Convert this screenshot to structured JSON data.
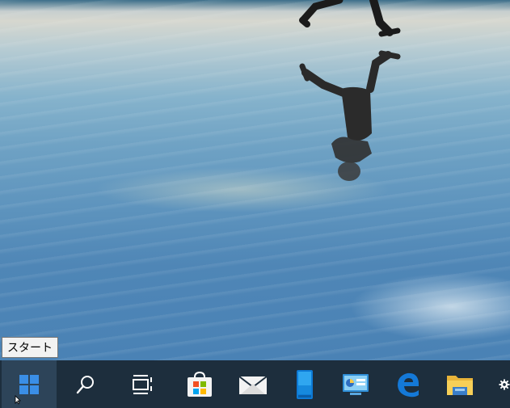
{
  "wallpaper": {
    "description_icon": "beach-reflection-wallpaper"
  },
  "tooltip": {
    "text": "スタート"
  },
  "taskbar": {
    "items": [
      {
        "name": "start-button",
        "icon": "windows-logo-icon"
      },
      {
        "name": "search-button",
        "icon": "search-icon"
      },
      {
        "name": "task-view-button",
        "icon": "task-view-icon"
      },
      {
        "name": "microsoft-store-button",
        "icon": "store-icon"
      },
      {
        "name": "mail-button",
        "icon": "mail-icon"
      },
      {
        "name": "phone-button",
        "icon": "phone-icon"
      },
      {
        "name": "control-panel-button",
        "icon": "control-panel-icon"
      },
      {
        "name": "edge-button",
        "icon": "edge-icon"
      },
      {
        "name": "file-explorer-button",
        "icon": "folder-icon"
      },
      {
        "name": "settings-button",
        "icon": "gear-icon"
      }
    ]
  },
  "colors": {
    "taskbar": "#1d2e3d",
    "accent": "#3a8ee6"
  }
}
